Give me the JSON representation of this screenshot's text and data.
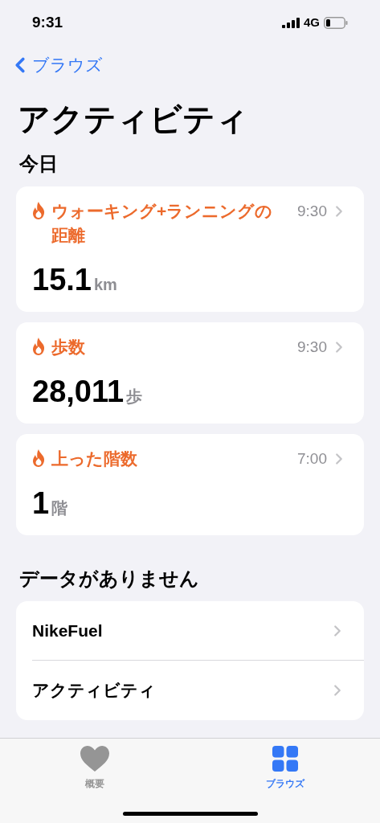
{
  "status_bar": {
    "time": "9:31",
    "network": "4G"
  },
  "nav": {
    "back": "ブラウズ"
  },
  "title": "アクティビティ",
  "sections": [
    {
      "heading": "今日",
      "kind": "metrics",
      "items": [
        {
          "title": "ウォーキング+ランニングの距離",
          "time": "9:30",
          "value": "15.1",
          "unit": "km"
        },
        {
          "title": "歩数",
          "time": "9:30",
          "value": "28,011",
          "unit": "歩"
        },
        {
          "title": "上った階数",
          "time": "7:00",
          "value": "1",
          "unit": "階"
        }
      ]
    },
    {
      "heading": "データがありません",
      "kind": "list",
      "items": [
        {
          "label": "NikeFuel"
        },
        {
          "label": "アクティビティ"
        }
      ]
    }
  ],
  "tab_bar": [
    {
      "label": "概要",
      "selected": false
    },
    {
      "label": "ブラウズ",
      "selected": true
    }
  ]
}
